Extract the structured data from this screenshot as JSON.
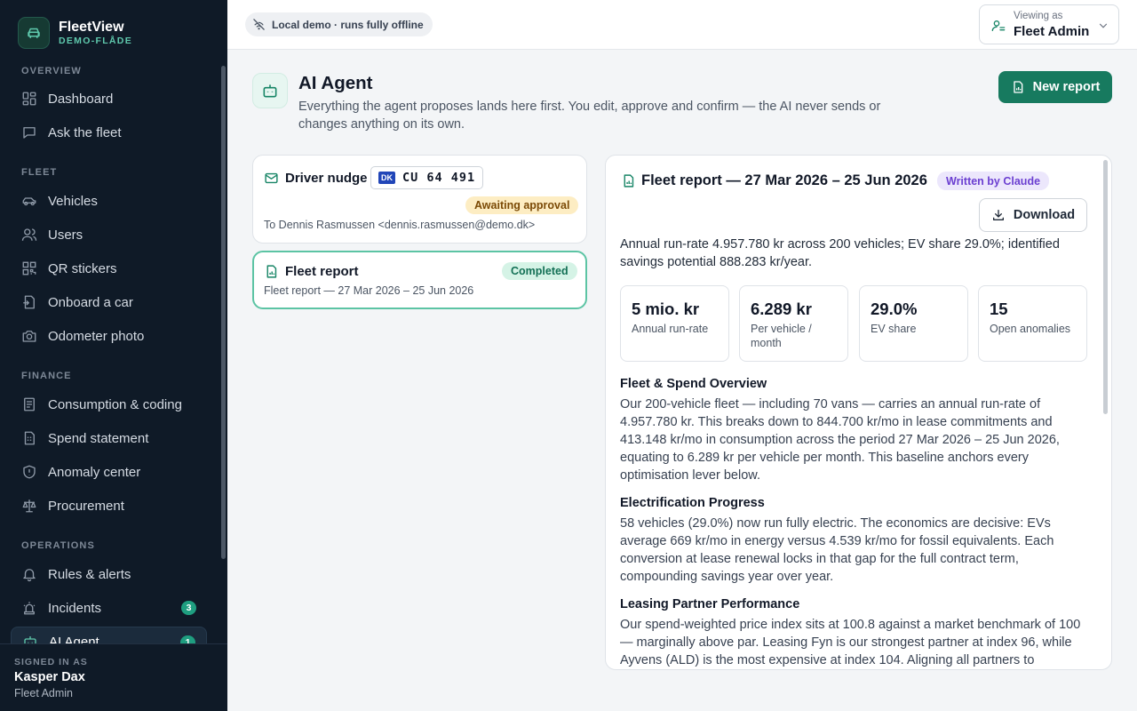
{
  "app": {
    "name": "FleetView",
    "subtitle": "DEMO-FLÅDE"
  },
  "sidebar": {
    "sections": [
      {
        "label": "OVERVIEW",
        "items": [
          {
            "label": "Dashboard",
            "icon": "dashboard-icon"
          },
          {
            "label": "Ask the fleet",
            "icon": "chat-icon"
          }
        ]
      },
      {
        "label": "FLEET",
        "items": [
          {
            "label": "Vehicles",
            "icon": "car-icon"
          },
          {
            "label": "Users",
            "icon": "users-icon"
          },
          {
            "label": "QR stickers",
            "icon": "qr-icon"
          },
          {
            "label": "Onboard a car",
            "icon": "onboard-icon"
          },
          {
            "label": "Odometer photo",
            "icon": "camera-icon"
          }
        ]
      },
      {
        "label": "FINANCE",
        "items": [
          {
            "label": "Consumption & coding",
            "icon": "receipt-icon"
          },
          {
            "label": "Spend statement",
            "icon": "statement-icon"
          },
          {
            "label": "Anomaly center",
            "icon": "shield-alert-icon"
          },
          {
            "label": "Procurement",
            "icon": "scale-icon"
          }
        ]
      },
      {
        "label": "OPERATIONS",
        "items": [
          {
            "label": "Rules & alerts",
            "icon": "bell-icon"
          },
          {
            "label": "Incidents",
            "icon": "siren-icon",
            "badge": "3"
          },
          {
            "label": "AI Agent",
            "icon": "bot-icon",
            "badge": "1",
            "active": true
          }
        ]
      }
    ],
    "footer": {
      "label": "SIGNED IN AS",
      "name": "Kasper Dax",
      "role": "Fleet Admin"
    }
  },
  "topbar": {
    "offline_badge": "Local demo · runs fully offline",
    "viewer_label": "Viewing as",
    "viewer_role": "Fleet Admin"
  },
  "header": {
    "title": "AI Agent",
    "description": "Everything the agent proposes lands here first. You edit, approve and confirm — the AI never sends or changes anything on its own.",
    "new_report_label": "New report"
  },
  "proposals": [
    {
      "title": "Driver nudge",
      "plate_country": "DK",
      "plate_number": "CU 64 491",
      "status": "Awaiting approval",
      "subtitle": "To Dennis Rasmussen <dennis.rasmussen@demo.dk>"
    },
    {
      "title": "Fleet report",
      "status": "Completed",
      "subtitle": "Fleet report — 27 Mar 2026 – 25 Jun 2026"
    }
  ],
  "report": {
    "title": "Fleet report — 27 Mar 2026 – 25 Jun 2026",
    "author_badge": "Written by Claude",
    "download_label": "Download",
    "summary": "Annual run-rate 4.957.780 kr across 200 vehicles; EV share 29.0%; identified savings potential 888.283 kr/year.",
    "kpis": [
      {
        "value": "5 mio. kr",
        "label": "Annual run-rate"
      },
      {
        "value": "6.289 kr",
        "label": "Per vehicle / month"
      },
      {
        "value": "29.0%",
        "label": "EV share"
      },
      {
        "value": "15",
        "label": "Open anomalies"
      }
    ],
    "sections": [
      {
        "heading": "Fleet & Spend Overview",
        "body": "Our 200-vehicle fleet — including 70 vans — carries an annual run-rate of 4.957.780 kr. This breaks down to 844.700 kr/mo in lease commitments and 413.148 kr/mo in consumption across the period 27 Mar 2026 – 25 Jun 2026, equating to 6.289 kr per vehicle per month. This baseline anchors every optimisation lever below."
      },
      {
        "heading": "Electrification Progress",
        "body": "58 vehicles (29.0%) now run fully electric. The economics are decisive: EVs average 669 kr/mo in energy versus 4.539 kr/mo for fossil equivalents. Each conversion at lease renewal locks in that gap for the full contract term, compounding savings year over year."
      },
      {
        "heading": "Leasing Partner Performance",
        "body": "Our spend-weighted price index sits at 100.8 against a market benchmark of 100 — marginally above par. Leasing Fyn is our strongest partner at index 96, while Ayvens (ALD) is the most expensive at index 104. Aligning all partners to"
      }
    ]
  },
  "colors": {
    "accent": "#177a5f",
    "sidebar_bg": "#0f1a27",
    "awaiting": "#fdedc3",
    "completed": "#d5f3e6",
    "claude": "#ece7fc"
  }
}
